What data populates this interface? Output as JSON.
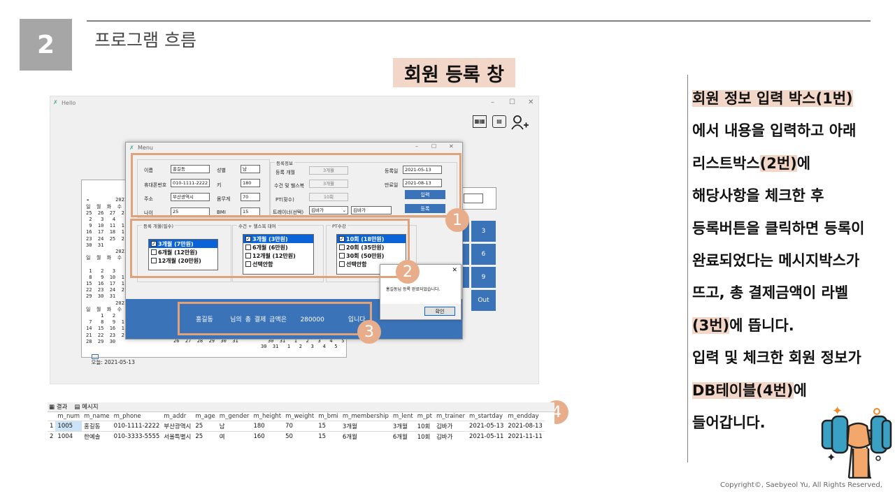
{
  "slide": {
    "number": "2",
    "section_title": "프로그램 흐름",
    "screen_title": "회원 등록 창",
    "copyright": "Copyright©, Saebyeol Yu, All Rights Reserved,"
  },
  "description": {
    "l1": "회원 정보 입력 박스(1번)",
    "l2": "에서 내용을 입력하고 아래",
    "l3a": "리스트박스",
    "l3b": "(2번)",
    "l3c": "에",
    "l4": "해당사항을 체크한 후",
    "l5": "등록버튼을 클릭하면 등록이",
    "l6": "완료되었다는 메시지박스가",
    "l7": "뜨고, 총 결제금액이 라벨",
    "l8a": "(3번)",
    "l8b": "에 뜹니다.",
    "l9": "입력 및 체크한 회원 정보가",
    "l10a": "DB테이블(4번)",
    "l10b": "에",
    "l11": "들어갑니다."
  },
  "main_window": {
    "title": "Hello",
    "ctrl_min": "–",
    "ctrl_max": "☐",
    "ctrl_close": "✕",
    "icons": [
      "calculator-icon",
      "calendar-icon",
      "add-user-icon"
    ],
    "keypad": [
      "3",
      "6",
      "9",
      "Out"
    ]
  },
  "calendar": {
    "text": "◂         2021\n일  월  화  수\n25  26  27  2\n 2   3   4\n 9  10  11  1\n16  17  18  1\n23  24  25  2\n30  31\n          2021\n일  월  화  수\n\n 1   2   3\n 8   9  10  1\n15  16  17  1\n22  23  24  2\n29  30  31\n          2021\n일  월  화  수\n     1   2\n 7   8   9  1\n14  15  16  1\n21  22  23  2\n28  29  30",
    "bottom_row": "26  27  28  29  30  31          30  31   1   2   3   4   5",
    "bottom_row2": "30  31   1   2   3   4   5",
    "today": "오늘: 2021-05-13"
  },
  "menu": {
    "title": "Menu",
    "name_label": "이름",
    "name_value": "홍길동",
    "phone_label": "휴대폰번호",
    "phone_value": "010-1111-2222",
    "addr_label": "주소",
    "addr_value": "부산광역시",
    "age_label": "나이",
    "age_value": "25",
    "gender_label": "성별",
    "gender_value": "남",
    "height_label": "키",
    "height_value": "180",
    "weight_label": "몸무게",
    "weight_value": "70",
    "bmi_label": "BMI",
    "bmi_value": "15",
    "reg_group": "등록정보",
    "reg_month_label": "등록 개월",
    "reg_month_value": "3개월",
    "towel_label": "수건 및 웰스복",
    "towel_value": "3개월",
    "pt_label": "PT(횟수)",
    "pt_value": "10회",
    "trainer_label": "트레이너(선택)",
    "trainer_select": "김바가",
    "trainer_value": "김바가",
    "reg_date_label": "등록일",
    "reg_date_value": "2021-05-13",
    "end_date_label": "만료일",
    "end_date_value": "2021-08-13",
    "input_button": "입력",
    "register_button": "등록",
    "list1_title": "등록 개월(필수)",
    "list1": [
      {
        "t": "3개월 (7만원)",
        "c": true
      },
      {
        "t": "6개월 (12만원)",
        "c": false
      },
      {
        "t": "12개월 (20만원)",
        "c": false
      }
    ],
    "list2_title": "수건 + 헬스복 대여",
    "list2": [
      {
        "t": "3개월 (3만원)",
        "c": true
      },
      {
        "t": "6개월 (6만원)",
        "c": false
      },
      {
        "t": "12개월 (12만원)",
        "c": false
      },
      {
        "t": "선택안함",
        "c": false
      }
    ],
    "list3_title": "PT수강",
    "list3": [
      {
        "t": "10회 (18만원)",
        "c": true
      },
      {
        "t": "20회 (35만원)",
        "c": false
      },
      {
        "t": "30회 (50만원)",
        "c": false
      },
      {
        "t": "선택안함",
        "c": false
      }
    ],
    "total": {
      "name": "홍길동",
      "mid": "님의  총  결제  금액은",
      "amount": "280000",
      "end": "입니다."
    }
  },
  "messagebox": {
    "text": "홍길동님 등록 완료되었습니다.",
    "ok": "확인",
    "close": "✕"
  },
  "markers": [
    "1",
    "2",
    "3",
    "4"
  ],
  "db": {
    "tab_results": "결과",
    "tab_messages": "메시지",
    "columns": [
      "",
      "m_num",
      "m_name",
      "m_phone",
      "m_addr",
      "m_age",
      "m_gender",
      "m_height",
      "m_weight",
      "m_bmi",
      "m_membership",
      "m_lent",
      "m_pt",
      "m_trainer",
      "m_startday",
      "m_endday"
    ],
    "rows": [
      [
        "1",
        "1005",
        "홍길동",
        "010-1111-2222",
        "부산광역시",
        "25",
        "남",
        "180",
        "70",
        "15",
        "3개월",
        "3개월",
        "10회",
        "김바가",
        "2021-05-13",
        "2021-08-13"
      ],
      [
        "2",
        "1004",
        "한예솔",
        "010-3333-5555",
        "서울특별시",
        "25",
        "여",
        "160",
        "50",
        "15",
        "6개월",
        "6개월",
        "10회",
        "김바가",
        "2021-05-11",
        "2021-11-11"
      ]
    ]
  }
}
